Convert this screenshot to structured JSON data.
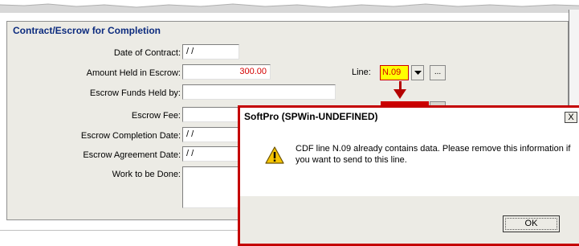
{
  "section": {
    "title": "Contract/Escrow for Completion"
  },
  "fields": {
    "date_of_contract": {
      "label": "Date of Contract:",
      "value": " / /"
    },
    "amount_held": {
      "label": "Amount Held in Escrow:",
      "value": "300.00"
    },
    "funds_held_by": {
      "label": "Escrow Funds Held by:",
      "value": ""
    },
    "escrow_fee": {
      "label": "Escrow Fee:",
      "value": ""
    },
    "completion_date": {
      "label": "Escrow Completion Date:",
      "value": " / /"
    },
    "agreement_date": {
      "label": "Escrow Agreement Date:",
      "value": " / /"
    },
    "work_to_be_done": {
      "label": "Work to be Done:",
      "value": ""
    }
  },
  "line": {
    "label": "Line:",
    "value": "N.09",
    "ellipsis": "..."
  },
  "dialog": {
    "title": "SoftPro (SPWin-UNDEFINED)",
    "close": "X",
    "message": "CDF line N.09 already contains data.  Please remove this information if you want to send to this line.",
    "ok_label": "OK",
    "icon": "warning-icon"
  },
  "colors": {
    "accent_red": "#c40000",
    "highlight_yellow": "#ffff00",
    "title_blue": "#0c2b7e"
  }
}
